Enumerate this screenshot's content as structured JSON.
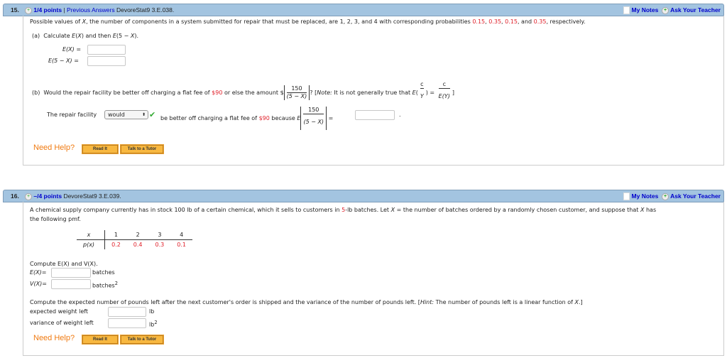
{
  "q15": {
    "number": "15.",
    "points": "1/4 points",
    "separator": "|",
    "previous": "Previous Answers",
    "source": "DevoreStat9 3.E.038.",
    "my_notes": "My Notes",
    "ask": "Ask Your Teacher",
    "intro": [
      "Possible values of ",
      "X",
      ", the number of components in a system submitted for repair that must be replaced, are 1, 2, 3, and 4 with corresponding probabilities ",
      "0.15",
      ", ",
      "0.35",
      ", ",
      "0.15",
      ", and ",
      "0.35",
      ", respectively."
    ],
    "a_label": "(a)",
    "a_text": [
      "Calculate ",
      "E",
      "(",
      "X",
      ") and then ",
      "E",
      "(5 − ",
      "X",
      ")."
    ],
    "ex_label": "E(X) =",
    "e5x_label": "E(5 − X) =",
    "b_label": "(b)",
    "b_text": "Would the repair facility be better off charging a flat fee of ",
    "fee": "$90",
    "b_text2": " or else the amount $",
    "frac_num": "150",
    "frac_den": "(5 − X)",
    "q_mark": "?",
    "note_label": "Note:",
    "note_text": " It is not generally true that ",
    "E": "E",
    "c": "c",
    "Y": "Y",
    "EY": "E(Y)",
    "eq": "=",
    "repair_text": "The repair facility",
    "select_value": "would",
    "repair_text2": "be better off charging a flat fee of ",
    "repair_text3": " because ",
    "period": ".",
    "need_help": "Need Help?",
    "read_it": "Read It",
    "tutor": "Talk to a Tutor"
  },
  "q16": {
    "number": "16.",
    "points": "–/4 points",
    "source": "DevoreStat9 3.E.039.",
    "my_notes": "My Notes",
    "ask": "Ask Your Teacher",
    "intro1": "A chemical supply company currently has in stock 100 lb of a certain chemical, which it sells to customers in ",
    "intro_red": "5",
    "intro2": "-lb batches. Let ",
    "X": "X",
    "intro3": " = the number of batches ordered by a randomly chosen customer, and suppose that ",
    "intro4": " has",
    "intro5": "the following pmf.",
    "table": {
      "x_label": "x",
      "px_label": "p(x)",
      "x": [
        "1",
        "2",
        "3",
        "4"
      ],
      "p": [
        "0.2",
        "0.4",
        "0.3",
        "0.1"
      ]
    },
    "compute1": "Compute E(X) and V(X).",
    "ex": "E(X)=",
    "vx": "V(X)=",
    "batches": "batches",
    "batches2": "batches",
    "sup": "2",
    "compute2": "Compute the expected number of pounds left after the next customer's order is shipped and the variance of the number of pounds left. [",
    "hint": "Hint:",
    "compute3": " The number of pounds left is a linear function of ",
    "compute4": ".]",
    "ew": "expected weight left",
    "vw": "variance of weight left",
    "lb": "lb",
    "lb2": "lb",
    "need_help": "Need Help?",
    "read_it": "Read It",
    "tutor": "Talk to a Tutor"
  }
}
